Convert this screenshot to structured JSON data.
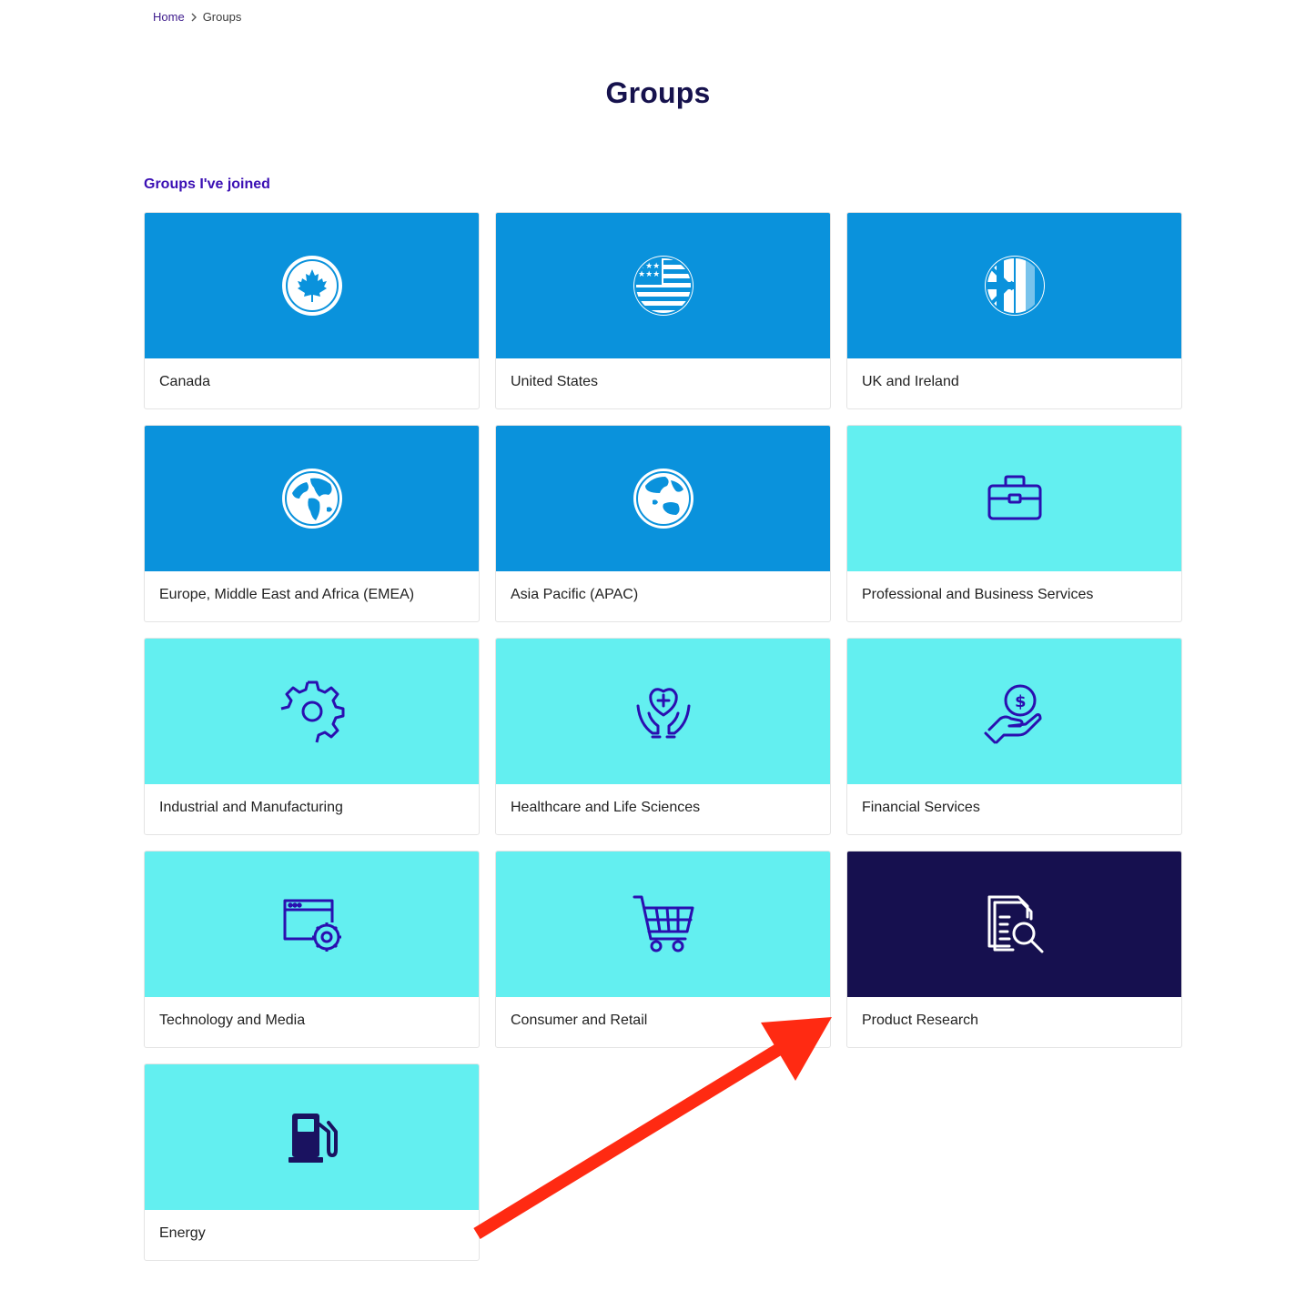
{
  "breadcrumb": {
    "home": "Home",
    "current": "Groups"
  },
  "page": {
    "title": "Groups"
  },
  "section": {
    "title": "Groups I've joined"
  },
  "groups": [
    {
      "label": "Canada",
      "icon": "canada-flag-icon",
      "color": "#0a92dc"
    },
    {
      "label": "United States",
      "icon": "us-flag-icon",
      "color": "#0a92dc"
    },
    {
      "label": "UK and Ireland",
      "icon": "uk-ireland-flag-icon",
      "color": "#0a92dc"
    },
    {
      "label": "Europe, Middle East and Africa (EMEA)",
      "icon": "globe-emea-icon",
      "color": "#0a92dc"
    },
    {
      "label": "Asia Pacific (APAC)",
      "icon": "globe-apac-icon",
      "color": "#0a92dc"
    },
    {
      "label": "Professional and Business Services",
      "icon": "briefcase-icon",
      "color": "#63eff0"
    },
    {
      "label": "Industrial and Manufacturing",
      "icon": "gear-icon",
      "color": "#63eff0"
    },
    {
      "label": "Healthcare and Life Sciences",
      "icon": "heart-hands-icon",
      "color": "#63eff0"
    },
    {
      "label": "Financial Services",
      "icon": "money-hand-icon",
      "color": "#63eff0"
    },
    {
      "label": "Technology and Media",
      "icon": "browser-gear-icon",
      "color": "#63eff0"
    },
    {
      "label": "Consumer and Retail",
      "icon": "shopping-cart-icon",
      "color": "#63eff0"
    },
    {
      "label": "Product Research",
      "icon": "document-search-icon",
      "color": "#16104f"
    },
    {
      "label": "Energy",
      "icon": "fuel-pump-icon",
      "color": "#63eff0"
    }
  ],
  "colors": {
    "title": "#16124d",
    "section_title": "#3b10b4",
    "icon_stroke_dark": "#2a0fb0",
    "annotation_arrow": "#ff2a12"
  }
}
